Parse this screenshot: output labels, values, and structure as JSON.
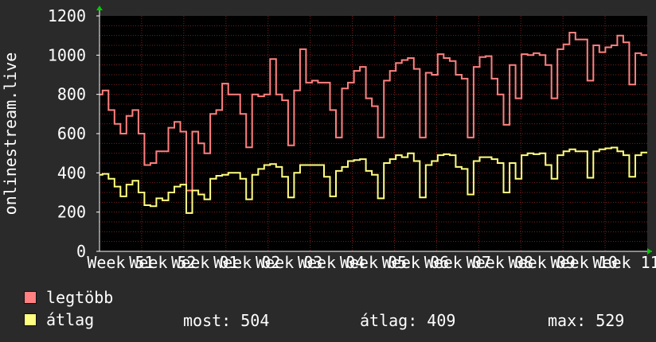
{
  "chart_data": {
    "type": "line",
    "ylabel": "onlinestream.live",
    "ylim": [
      0,
      1200
    ],
    "yticks": [
      0,
      200,
      400,
      600,
      800,
      1000,
      1200
    ],
    "x_tick_labels": [
      "Week 51",
      "Week 52",
      "Week 01",
      "Week 02",
      "Week 03",
      "Week 04",
      "Week 05",
      "Week 06",
      "Week 07",
      "Week 08",
      "Week 09",
      "Week 10",
      "Week 11"
    ],
    "grid": true,
    "colors": {
      "background": "#2a2a2a",
      "plot": "#000000",
      "grid": "#7a2020",
      "axis": "#ffffff",
      "arrow": "#00cc00"
    },
    "series": [
      {
        "name": "legtöbb",
        "color": "#ff8080",
        "values": [
          800,
          820,
          820,
          720,
          720,
          650,
          650,
          600,
          600,
          690,
          690,
          720,
          720,
          600,
          600,
          440,
          440,
          450,
          450,
          510,
          510,
          510,
          510,
          630,
          630,
          660,
          660,
          610,
          610,
          310,
          310,
          610,
          610,
          550,
          550,
          500,
          500,
          700,
          700,
          720,
          720,
          855,
          855,
          800,
          800,
          800,
          800,
          700,
          700,
          530,
          530,
          800,
          800,
          790,
          790,
          800,
          800,
          980,
          980,
          800,
          800,
          770,
          770,
          540,
          540,
          820,
          820,
          1030,
          1030,
          860,
          860,
          870,
          870,
          860,
          860,
          860,
          860,
          720,
          720,
          580,
          580,
          830,
          830,
          860,
          860,
          920,
          920,
          940,
          940,
          780,
          780,
          740,
          740,
          580,
          580,
          870,
          870,
          920,
          920,
          960,
          960,
          975,
          975,
          985,
          985,
          930,
          930,
          580,
          580,
          910,
          910,
          900,
          900,
          1005,
          1005,
          985,
          985,
          970,
          970,
          900,
          900,
          880,
          880,
          580,
          580,
          940,
          940,
          990,
          990,
          995,
          995,
          880,
          880,
          800,
          800,
          645,
          645,
          950,
          950,
          780,
          780,
          1005,
          1005,
          1000,
          1000,
          1010,
          1010,
          1000,
          1000,
          950,
          950,
          780,
          780,
          1030,
          1030,
          1055,
          1055,
          1115,
          1115,
          1080,
          1080,
          1080,
          1080,
          870,
          870,
          1050,
          1050,
          1015,
          1015,
          1040,
          1040,
          1050,
          1050,
          1100,
          1100,
          1065,
          1065,
          850,
          850,
          1010,
          1010,
          1000,
          1000
        ]
      },
      {
        "name": "átlag",
        "color": "#ffff80",
        "values": [
          390,
          395,
          395,
          370,
          370,
          330,
          330,
          280,
          280,
          340,
          340,
          360,
          360,
          300,
          300,
          235,
          235,
          230,
          230,
          270,
          270,
          260,
          260,
          300,
          300,
          330,
          330,
          340,
          340,
          195,
          195,
          310,
          310,
          290,
          290,
          265,
          265,
          370,
          370,
          385,
          385,
          390,
          390,
          400,
          400,
          400,
          400,
          370,
          370,
          265,
          265,
          390,
          390,
          420,
          420,
          440,
          440,
          445,
          445,
          430,
          430,
          380,
          380,
          275,
          275,
          400,
          400,
          440,
          440,
          440,
          440,
          440,
          440,
          440,
          440,
          380,
          380,
          280,
          280,
          410,
          410,
          430,
          430,
          460,
          460,
          465,
          465,
          470,
          470,
          410,
          410,
          390,
          390,
          270,
          270,
          450,
          450,
          470,
          470,
          490,
          490,
          480,
          480,
          500,
          500,
          460,
          460,
          275,
          275,
          440,
          440,
          460,
          460,
          490,
          490,
          495,
          495,
          490,
          490,
          430,
          430,
          420,
          420,
          290,
          290,
          460,
          460,
          480,
          480,
          480,
          480,
          470,
          470,
          450,
          450,
          300,
          300,
          450,
          450,
          370,
          370,
          490,
          490,
          500,
          500,
          495,
          495,
          500,
          500,
          440,
          440,
          370,
          370,
          490,
          490,
          510,
          510,
          520,
          520,
          510,
          510,
          510,
          510,
          375,
          375,
          510,
          510,
          520,
          520,
          525,
          525,
          529,
          529,
          510,
          510,
          490,
          490,
          380,
          380,
          490,
          490,
          504,
          504
        ]
      }
    ]
  },
  "legend": {
    "max_label": "legtöbb",
    "avg_label": "átlag"
  },
  "stats": {
    "current": "most: 504",
    "average": "átlag: 409",
    "maximum": "max: 529"
  }
}
